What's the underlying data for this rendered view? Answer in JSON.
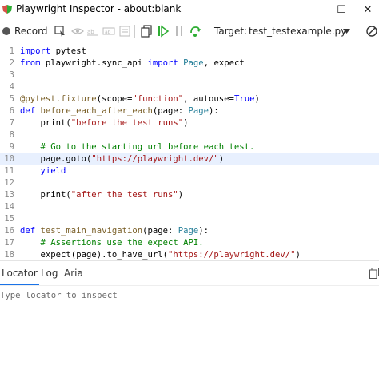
{
  "window": {
    "title": "Playwright Inspector - about:blank",
    "minimize": "—",
    "maximize": "☐",
    "close": "✕"
  },
  "toolbar": {
    "record_label": "Record",
    "target_label": "Target:",
    "target_value": "test_testexample.py"
  },
  "editor": {
    "highlighted_line": 10,
    "lines": [
      {
        "n": "1",
        "code": "import pytest"
      },
      {
        "n": "2",
        "code": "from playwright.sync_api import Page, expect"
      },
      {
        "n": "3",
        "code": ""
      },
      {
        "n": "4",
        "code": ""
      },
      {
        "n": "5",
        "code": "@pytest.fixture(scope=\"function\", autouse=True)"
      },
      {
        "n": "6",
        "code": "def before_each_after_each(page: Page):"
      },
      {
        "n": "7",
        "code": "    print(\"before the test runs\")"
      },
      {
        "n": "8",
        "code": ""
      },
      {
        "n": "9",
        "code": "    # Go to the starting url before each test."
      },
      {
        "n": "10",
        "code": "    page.goto(\"https://playwright.dev/\")"
      },
      {
        "n": "11",
        "code": "    yield"
      },
      {
        "n": "12",
        "code": ""
      },
      {
        "n": "13",
        "code": "    print(\"after the test runs\")"
      },
      {
        "n": "14",
        "code": ""
      },
      {
        "n": "15",
        "code": ""
      },
      {
        "n": "16",
        "code": "def test_main_navigation(page: Page):"
      },
      {
        "n": "17",
        "code": "    # Assertions use the expect API."
      },
      {
        "n": "18",
        "code": "    expect(page).to_have_url(\"https://playwright.dev/\")"
      }
    ]
  },
  "tabs": [
    "Locator",
    "Log",
    "Aria"
  ],
  "locator": {
    "placeholder": "Type locator to inspect"
  }
}
